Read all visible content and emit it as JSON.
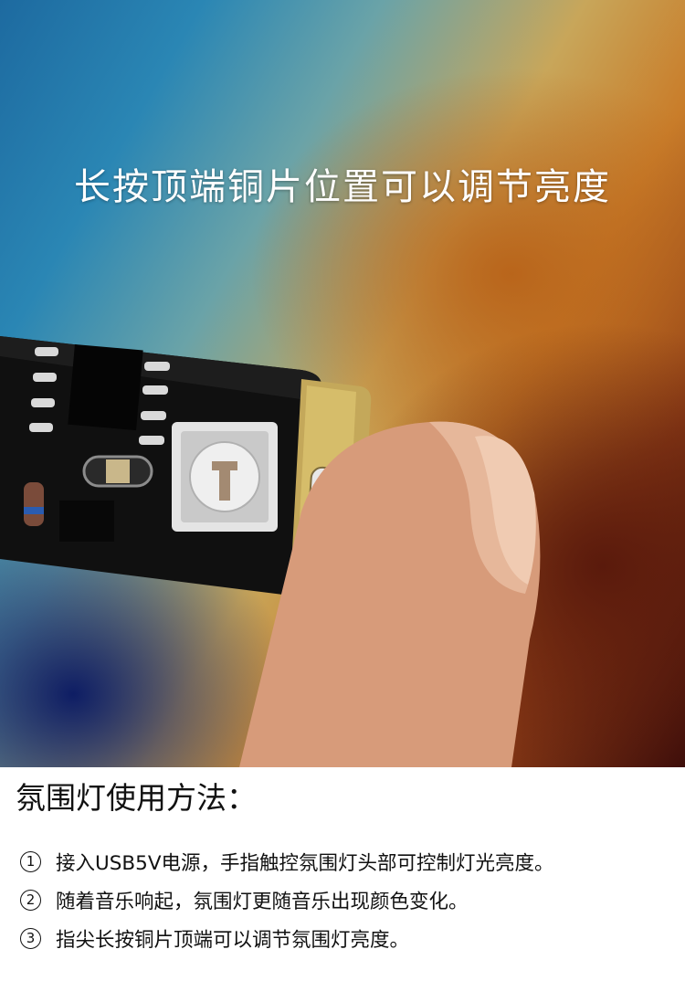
{
  "photo": {
    "headline": "长按顶端铜片位置可以调节亮度"
  },
  "instructions": {
    "title": "氛围灯使用方法：",
    "steps": [
      {
        "number": "1",
        "text": "接入USB5V电源，手指触控氛围灯头部可控制灯光亮度。"
      },
      {
        "number": "2",
        "text": "随着音乐响起，氛围灯更随音乐出现颜色变化。"
      },
      {
        "number": "3",
        "text": "指尖长按铜片顶端可以调节氛围灯亮度。"
      }
    ]
  }
}
